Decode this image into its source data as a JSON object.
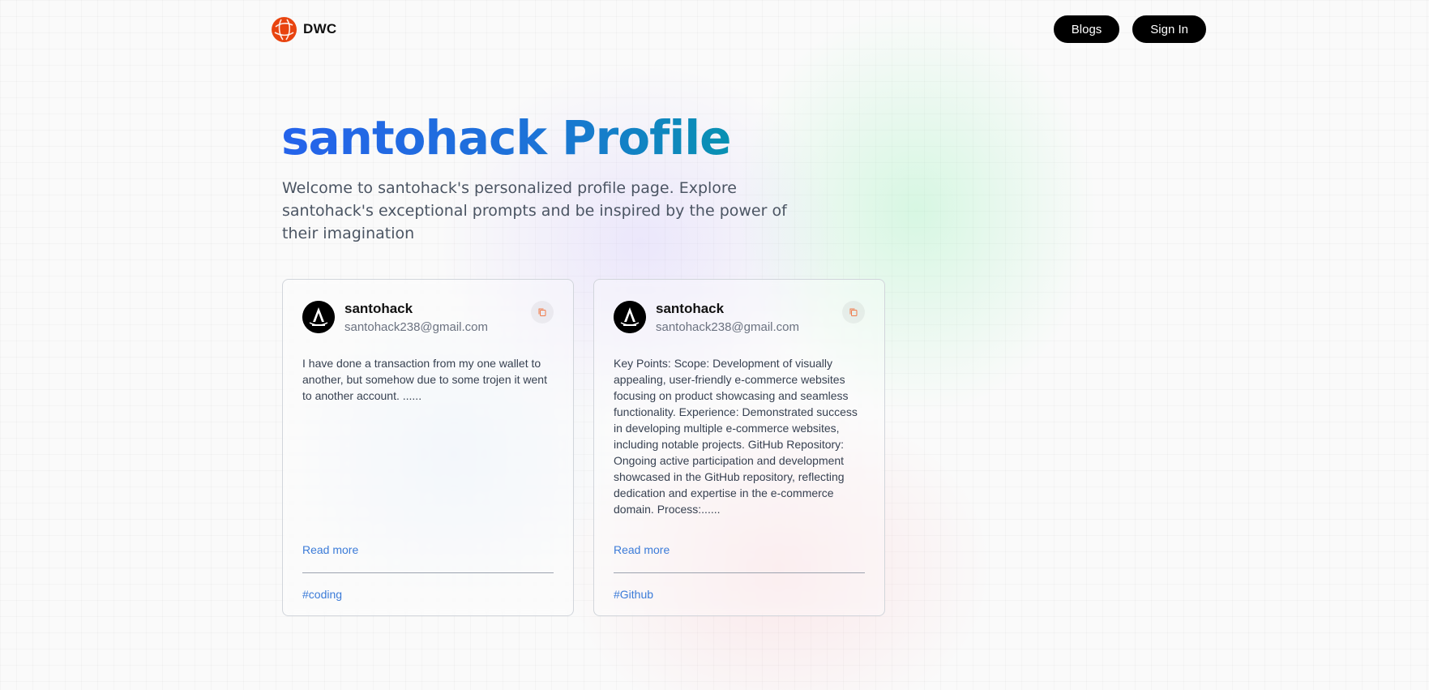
{
  "nav": {
    "brand": "DWC",
    "buttons": [
      "Blogs",
      "Sign In"
    ]
  },
  "hero": {
    "title_part1": "santohack",
    "title_part2": "Profile",
    "subtitle": "Welcome to santohack's personalized profile page. Explore santohack's exceptional prompts and be inspired by the power of their imagination"
  },
  "cards": [
    {
      "username": "santohack",
      "email": "santohack238@gmail.com",
      "body": "I have done a transaction from my one wallet to another, but somehow due to some trojen it went to another account. ......",
      "read_more": "Read more",
      "tag": "#coding"
    },
    {
      "username": "santohack",
      "email": "santohack238@gmail.com",
      "body": "Key Points: Scope: Development of visually appealing, user-friendly e-commerce websites focusing on product showcasing and seamless functionality. Experience: Demonstrated success in developing multiple e-commerce websites, including notable projects. GitHub Repository: Ongoing active participation and development showcased in the GitHub repository, reflecting dedication and expertise in the e-commerce domain. Process:......",
      "read_more": "Read more",
      "tag": "#Github"
    }
  ],
  "colors": {
    "brand_orange": "#e8430f",
    "title_gradient_start": "#2563eb",
    "title_gradient_end": "#0891b2",
    "link_blue": "#3b7bd8"
  },
  "icons": {
    "brand": "globe-logo-icon",
    "copy": "copy-icon",
    "avatar": "user-avatar-icon"
  }
}
